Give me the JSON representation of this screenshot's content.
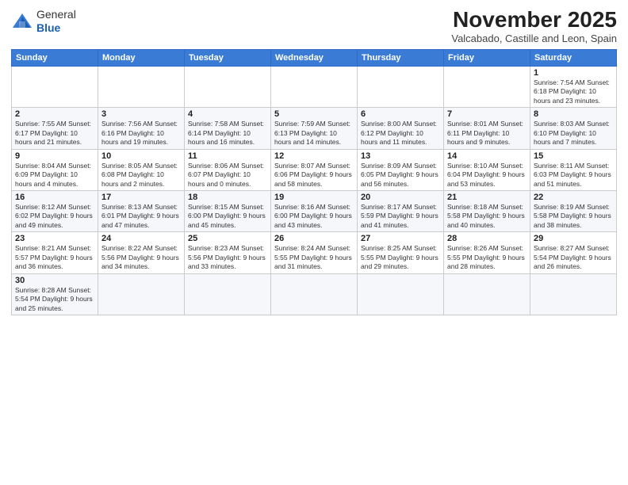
{
  "header": {
    "logo_general": "General",
    "logo_blue": "Blue",
    "month_title": "November 2025",
    "subtitle": "Valcabado, Castille and Leon, Spain"
  },
  "days_of_week": [
    "Sunday",
    "Monday",
    "Tuesday",
    "Wednesday",
    "Thursday",
    "Friday",
    "Saturday"
  ],
  "weeks": [
    [
      {
        "day": "",
        "info": ""
      },
      {
        "day": "",
        "info": ""
      },
      {
        "day": "",
        "info": ""
      },
      {
        "day": "",
        "info": ""
      },
      {
        "day": "",
        "info": ""
      },
      {
        "day": "",
        "info": ""
      },
      {
        "day": "1",
        "info": "Sunrise: 7:54 AM\nSunset: 6:18 PM\nDaylight: 10 hours and 23 minutes."
      }
    ],
    [
      {
        "day": "2",
        "info": "Sunrise: 7:55 AM\nSunset: 6:17 PM\nDaylight: 10 hours and 21 minutes."
      },
      {
        "day": "3",
        "info": "Sunrise: 7:56 AM\nSunset: 6:16 PM\nDaylight: 10 hours and 19 minutes."
      },
      {
        "day": "4",
        "info": "Sunrise: 7:58 AM\nSunset: 6:14 PM\nDaylight: 10 hours and 16 minutes."
      },
      {
        "day": "5",
        "info": "Sunrise: 7:59 AM\nSunset: 6:13 PM\nDaylight: 10 hours and 14 minutes."
      },
      {
        "day": "6",
        "info": "Sunrise: 8:00 AM\nSunset: 6:12 PM\nDaylight: 10 hours and 11 minutes."
      },
      {
        "day": "7",
        "info": "Sunrise: 8:01 AM\nSunset: 6:11 PM\nDaylight: 10 hours and 9 minutes."
      },
      {
        "day": "8",
        "info": "Sunrise: 8:03 AM\nSunset: 6:10 PM\nDaylight: 10 hours and 7 minutes."
      }
    ],
    [
      {
        "day": "9",
        "info": "Sunrise: 8:04 AM\nSunset: 6:09 PM\nDaylight: 10 hours and 4 minutes."
      },
      {
        "day": "10",
        "info": "Sunrise: 8:05 AM\nSunset: 6:08 PM\nDaylight: 10 hours and 2 minutes."
      },
      {
        "day": "11",
        "info": "Sunrise: 8:06 AM\nSunset: 6:07 PM\nDaylight: 10 hours and 0 minutes."
      },
      {
        "day": "12",
        "info": "Sunrise: 8:07 AM\nSunset: 6:06 PM\nDaylight: 9 hours and 58 minutes."
      },
      {
        "day": "13",
        "info": "Sunrise: 8:09 AM\nSunset: 6:05 PM\nDaylight: 9 hours and 56 minutes."
      },
      {
        "day": "14",
        "info": "Sunrise: 8:10 AM\nSunset: 6:04 PM\nDaylight: 9 hours and 53 minutes."
      },
      {
        "day": "15",
        "info": "Sunrise: 8:11 AM\nSunset: 6:03 PM\nDaylight: 9 hours and 51 minutes."
      }
    ],
    [
      {
        "day": "16",
        "info": "Sunrise: 8:12 AM\nSunset: 6:02 PM\nDaylight: 9 hours and 49 minutes."
      },
      {
        "day": "17",
        "info": "Sunrise: 8:13 AM\nSunset: 6:01 PM\nDaylight: 9 hours and 47 minutes."
      },
      {
        "day": "18",
        "info": "Sunrise: 8:15 AM\nSunset: 6:00 PM\nDaylight: 9 hours and 45 minutes."
      },
      {
        "day": "19",
        "info": "Sunrise: 8:16 AM\nSunset: 6:00 PM\nDaylight: 9 hours and 43 minutes."
      },
      {
        "day": "20",
        "info": "Sunrise: 8:17 AM\nSunset: 5:59 PM\nDaylight: 9 hours and 41 minutes."
      },
      {
        "day": "21",
        "info": "Sunrise: 8:18 AM\nSunset: 5:58 PM\nDaylight: 9 hours and 40 minutes."
      },
      {
        "day": "22",
        "info": "Sunrise: 8:19 AM\nSunset: 5:58 PM\nDaylight: 9 hours and 38 minutes."
      }
    ],
    [
      {
        "day": "23",
        "info": "Sunrise: 8:21 AM\nSunset: 5:57 PM\nDaylight: 9 hours and 36 minutes."
      },
      {
        "day": "24",
        "info": "Sunrise: 8:22 AM\nSunset: 5:56 PM\nDaylight: 9 hours and 34 minutes."
      },
      {
        "day": "25",
        "info": "Sunrise: 8:23 AM\nSunset: 5:56 PM\nDaylight: 9 hours and 33 minutes."
      },
      {
        "day": "26",
        "info": "Sunrise: 8:24 AM\nSunset: 5:55 PM\nDaylight: 9 hours and 31 minutes."
      },
      {
        "day": "27",
        "info": "Sunrise: 8:25 AM\nSunset: 5:55 PM\nDaylight: 9 hours and 29 minutes."
      },
      {
        "day": "28",
        "info": "Sunrise: 8:26 AM\nSunset: 5:55 PM\nDaylight: 9 hours and 28 minutes."
      },
      {
        "day": "29",
        "info": "Sunrise: 8:27 AM\nSunset: 5:54 PM\nDaylight: 9 hours and 26 minutes."
      }
    ],
    [
      {
        "day": "30",
        "info": "Sunrise: 8:28 AM\nSunset: 5:54 PM\nDaylight: 9 hours and 25 minutes."
      },
      {
        "day": "",
        "info": ""
      },
      {
        "day": "",
        "info": ""
      },
      {
        "day": "",
        "info": ""
      },
      {
        "day": "",
        "info": ""
      },
      {
        "day": "",
        "info": ""
      },
      {
        "day": "",
        "info": ""
      }
    ]
  ]
}
